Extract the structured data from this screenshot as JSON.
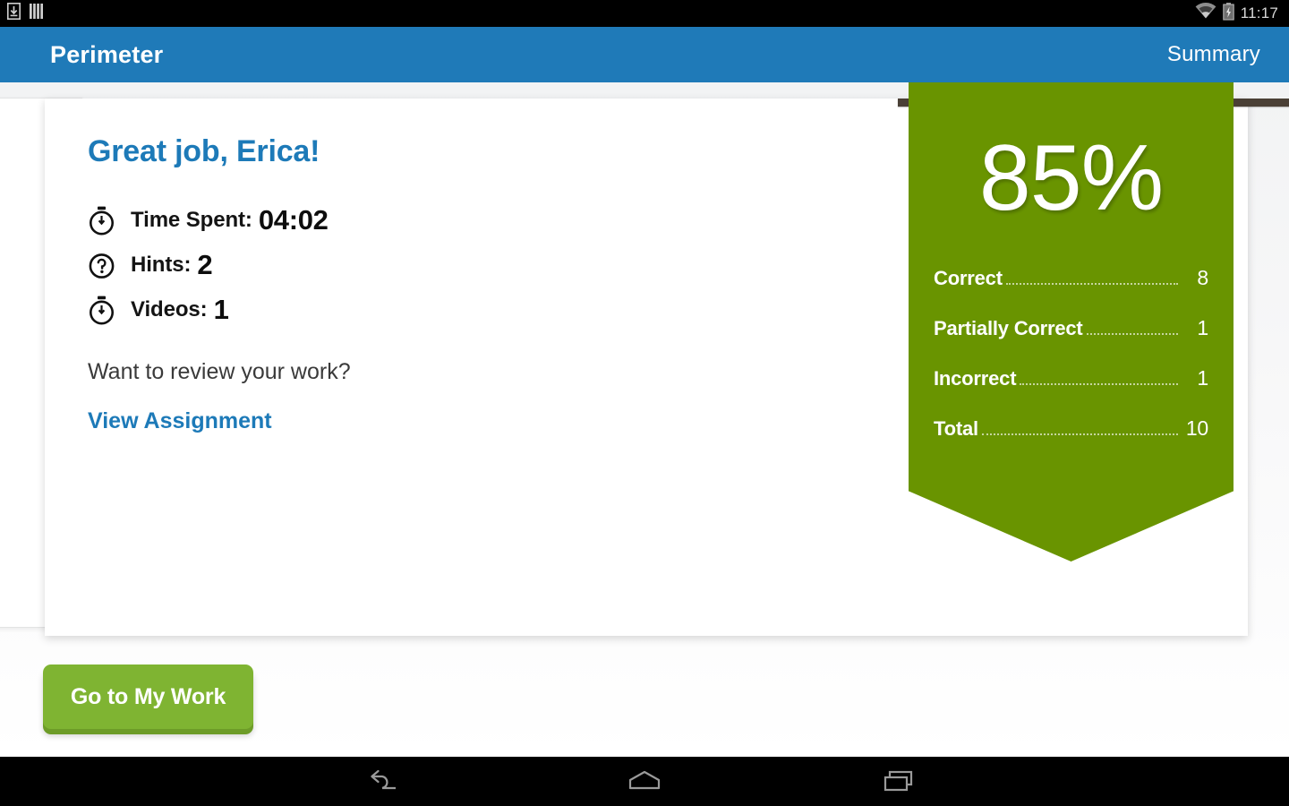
{
  "status_bar": {
    "icons": [
      "download-icon",
      "sim-signal-icon",
      "wifi-icon",
      "battery-charging-icon"
    ],
    "clock": "11:17"
  },
  "app_bar": {
    "title": "Perimeter",
    "action_label": "Summary"
  },
  "card": {
    "headline": "Great job, Erica!",
    "stats": [
      {
        "icon": "stopwatch-icon",
        "label": "Time Spent:",
        "value": "04:02"
      },
      {
        "icon": "question-circle-icon",
        "label": "Hints:",
        "value": "2"
      },
      {
        "icon": "stopwatch-icon",
        "label": "Videos:",
        "value": "1"
      }
    ],
    "review_prompt": "Want to review your work?",
    "review_link": "View Assignment"
  },
  "score_ribbon": {
    "percent": "85%",
    "rows": [
      {
        "label": "Correct",
        "value": "8"
      },
      {
        "label": "Partially Correct",
        "value": "1"
      },
      {
        "label": "Incorrect",
        "value": "1"
      },
      {
        "label": "Total",
        "value": "10"
      }
    ]
  },
  "primary_button": {
    "label": "Go to My Work"
  },
  "nav_bar": {
    "buttons": [
      "back-icon",
      "home-icon",
      "recents-icon"
    ]
  },
  "colors": {
    "app_bar_blue": "#1f7ab8",
    "link_blue": "#1d7ab8",
    "ribbon_green": "#699400",
    "button_green": "#7fb432",
    "button_shadow_green": "#6d9c28",
    "pin_brown": "#4a4036"
  }
}
